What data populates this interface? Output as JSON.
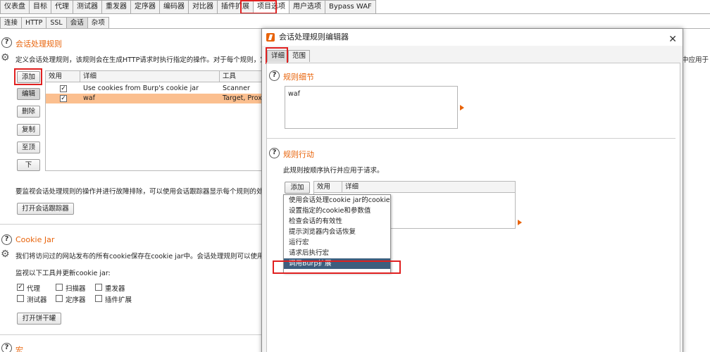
{
  "top_tabs": [
    {
      "label": "仪表盘"
    },
    {
      "label": "目标"
    },
    {
      "label": "代理"
    },
    {
      "label": "测试器"
    },
    {
      "label": "重发器"
    },
    {
      "label": "定序器"
    },
    {
      "label": "编码器"
    },
    {
      "label": "对比器"
    },
    {
      "label": "插件扩展"
    },
    {
      "label": "项目选项"
    },
    {
      "label": "用户选项"
    },
    {
      "label": "Bypass WAF"
    }
  ],
  "sub_tabs": [
    {
      "label": "连接"
    },
    {
      "label": "HTTP"
    },
    {
      "label": "SSL"
    },
    {
      "label": "会话"
    },
    {
      "label": "杂项"
    }
  ],
  "session_rules": {
    "title": "会话处理规则",
    "description": "定义会话处理规则，该规则会在生成HTTP请求时执行指定的操作。对于每个规则，定义",
    "description_right": "中应用于",
    "buttons": [
      "添加",
      "编辑",
      "删除",
      "复制",
      "至顶",
      "下"
    ],
    "columns": [
      "效用",
      "详细",
      "工具"
    ],
    "rows": [
      {
        "enabled": true,
        "detail": "Use cookies from Burp's cookie jar",
        "tools": "Scanner"
      },
      {
        "enabled": true,
        "detail": "waf",
        "tools": "Target, Proxy"
      }
    ],
    "tracer_desc": "要监视会话处理规则的操作并进行故障排除，可以使用会话跟踪器显示每个规则的处理",
    "tracer_button": "打开会话跟踪器"
  },
  "cookie_jar": {
    "title": "Cookie Jar",
    "description": "我们将访问过的网站发布的所有cookie保存在cookie jar中。会话处理规则可以使用和更",
    "monitor_label": "监视以下工具并更新cookie jar:",
    "tools": [
      {
        "label": "代理",
        "checked": true
      },
      {
        "label": "扫描器",
        "checked": false
      },
      {
        "label": "重发器",
        "checked": false
      },
      {
        "label": "测试器",
        "checked": false
      },
      {
        "label": "定序器",
        "checked": false
      },
      {
        "label": "插件扩展",
        "checked": false
      }
    ],
    "open_button": "打开饼干罐"
  },
  "macro": {
    "title": "宏"
  },
  "dialog": {
    "title": "会话处理规则编辑器",
    "tabs": [
      {
        "label": "详细"
      },
      {
        "label": "范围"
      }
    ],
    "rule_detail_title": "规则细节",
    "rule_description": "waf",
    "rule_actions_title": "规则行动",
    "rule_actions_desc": "此规则按顺序执行并应用于请求。",
    "add_button": "添加",
    "columns": [
      "效用",
      "详细"
    ],
    "menu_items": [
      "使用会话处理cookie jar的cookie",
      "设置指定的cookie和参数值",
      "检查会话的有效性",
      "提示浏览器内会话恢复",
      "运行宏",
      "请求后执行宏",
      "调用Burp扩展"
    ],
    "selected_menu_index": 6
  },
  "colors": {
    "accent": "#e8630a",
    "highlight": "#fbbf8f",
    "selection": "#3e5e7e",
    "annotation": "#e02020"
  }
}
